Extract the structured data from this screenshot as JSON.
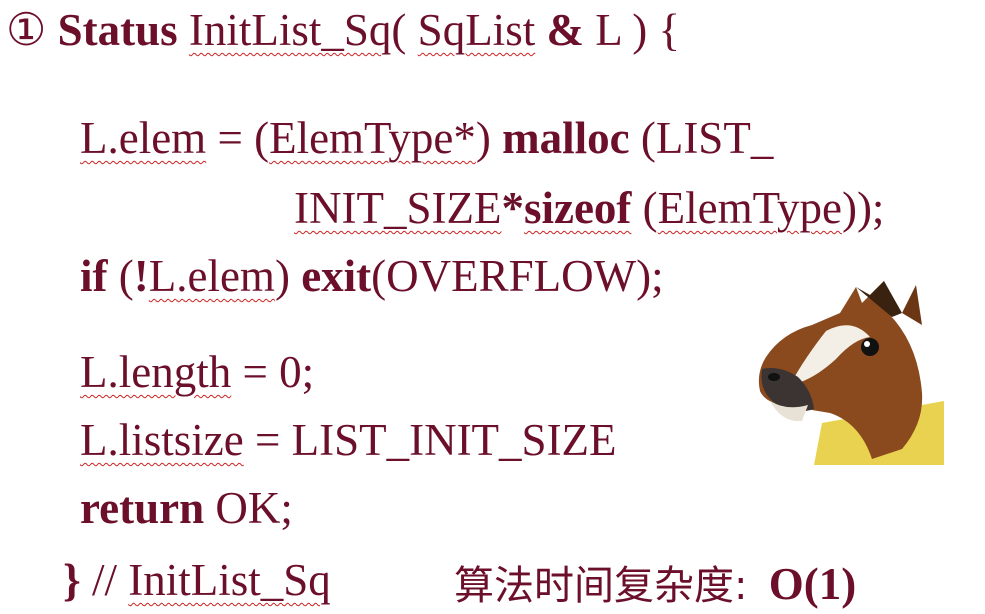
{
  "code": {
    "line1": {
      "num": "①",
      "kw": "Status",
      "fn": "InitList_Sq",
      "paren": "(",
      "param_type": "SqList",
      "amp": "&",
      "param_name": "L",
      "close": ") {"
    },
    "line2": {
      "lhs": "L.elem",
      "eq": "= (",
      "cast": "ElemType*",
      "close": ")",
      "kw": "malloc",
      "arg": "(LIST_"
    },
    "line3": {
      "arg": "INIT_SIZE",
      "star": "*",
      "kw": "sizeof",
      "paren": "(",
      "type": "ElemType",
      "close": "));"
    },
    "line4": {
      "kw": "if",
      "open": "(",
      "bang": "!",
      "cond": "L.elem",
      "close": ")",
      "kw2": "exit",
      "arg": "(OVERFLOW);"
    },
    "line5": {
      "lhs": "L.length",
      "rhs": "= 0;"
    },
    "line6": {
      "lhs": "L.listsize",
      "rhs": "= LIST_INIT_SIZE"
    },
    "line7": {
      "kw": "return",
      "val": "OK;"
    },
    "line8": {
      "brace": "}",
      "comment": "//",
      "fn": "InitList_Sq"
    }
  },
  "complexity": {
    "label": "算法时间复杂度:",
    "value": "O(1)"
  },
  "image": {
    "icon": "horse-head-mask-icon"
  },
  "colors": {
    "text": "#6b0f2a",
    "squiggle": "#cc2222"
  }
}
